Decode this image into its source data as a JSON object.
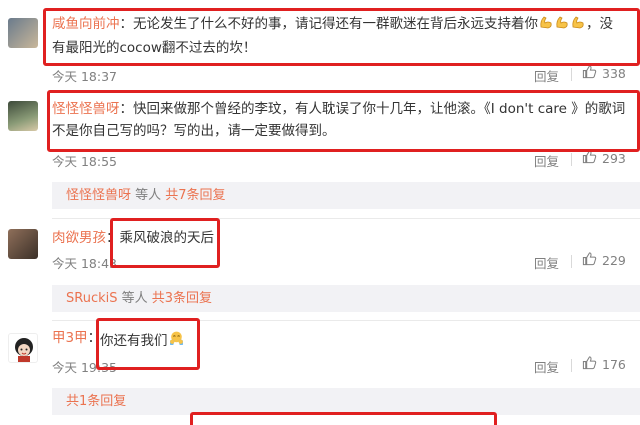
{
  "comments": [
    {
      "username": "咸鱼向前冲",
      "sep": "：",
      "text": "无论发生了什么不好的事，请记得还有一群歌迷在背后永远支持着你",
      "emoji_name": "strong-arm-emoji",
      "text_after": "，没有最阳光的cocow翻不过去的坎！",
      "time": "今天 18:37",
      "reply": "回复",
      "likes": "338"
    },
    {
      "username": "怪怪怪兽呀",
      "sep": "：",
      "text": "快回来做那个曾经的李玟，有人耽误了你十几年，让他滚。《I don't care 》的歌词不是你自己写的吗？写的出，请一定要做得到。",
      "time": "今天 18:55",
      "reply": "回复",
      "likes": "293",
      "sub_user": "怪怪怪兽呀",
      "sub_mid": " 等人 ",
      "sub_count": "共7条回复"
    },
    {
      "username": "肉欲男孩",
      "sep": "：",
      "text": "乘风破浪的天后",
      "time": "今天 18:43",
      "reply": "回复",
      "likes": "229",
      "sub_user": "SRuckiS",
      "sub_mid": " 等人 ",
      "sub_count": "共3条回复"
    },
    {
      "username": "甲3甲",
      "sep": "：",
      "text": "你还有我们",
      "emoji_name": "hug-emoji",
      "time": "今天 19:35",
      "reply": "回复",
      "likes": "176",
      "sub_count": "共1条回复"
    }
  ],
  "colors": {
    "username": "#eb7350",
    "highlight_box": "#e02020",
    "meta": "#808080"
  }
}
